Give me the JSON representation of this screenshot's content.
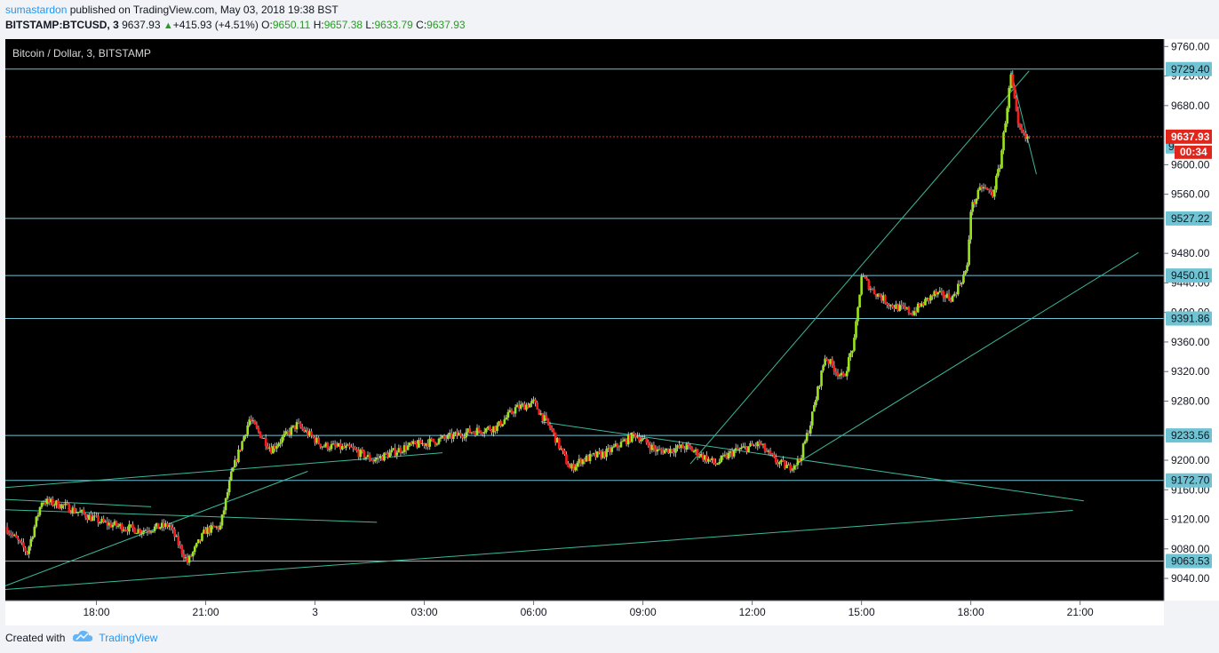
{
  "header": {
    "publisher": "sumastardon",
    "published_text": " published on TradingView.com, May 03, 2018 19:38 BST",
    "symbol": "BITSTAMP:BTCUSD, 3",
    "last": "9637.93",
    "change": "+415.93 (+4.51%)",
    "o_label": "O:",
    "o_value": "9650.11",
    "h_label": "H:",
    "h_value": "9657.38",
    "l_label": "L:",
    "l_value": "9633.79",
    "c_label": "C:",
    "c_value": "9637.93"
  },
  "footer": {
    "created_with": "Created with",
    "brand": "TradingView"
  },
  "colors": {
    "background": "#000000",
    "candle_up": "#9ce51c",
    "candle_down": "#ff1a1a",
    "horizontal_level": "#6fc3d2",
    "trendline": "#3cb89a",
    "last_price": "#e1251b",
    "axis_text": "#131722"
  },
  "chart_data": {
    "type": "candlestick",
    "title": "Bitcoin / Dollar, 3, BITSTAMP",
    "ylim": [
      9010,
      9770
    ],
    "y_ticks": [
      "9760.00",
      "9720.00",
      "9680.00",
      "9600.00",
      "9560.00",
      "9480.00",
      "9440.00",
      "9400.00",
      "9360.00",
      "9320.00",
      "9280.00",
      "9200.00",
      "9160.00",
      "9120.00",
      "9080.00",
      "9040.00"
    ],
    "x_ticks": [
      "18:00",
      "21:00",
      "3",
      "03:00",
      "06:00",
      "09:00",
      "12:00",
      "15:00",
      "18:00",
      "21:00"
    ],
    "x_tick_hours": [
      18,
      21,
      24,
      27,
      30,
      33,
      36,
      39,
      42,
      45
    ],
    "x_range_hours": [
      15.5,
      47.3
    ],
    "grid": false,
    "levels": [
      9729.4,
      9527.22,
      9450.01,
      9391.86,
      9233.56,
      9172.7,
      9063.53
    ],
    "level_labels": [
      "9729.40",
      "9527.22",
      "9450.01",
      "9391.86",
      "9233.56",
      "9172.70",
      "9063.53"
    ],
    "level_partial": "9",
    "last_price": 9637.93,
    "last_price_label": "9637.93",
    "countdown": "00:34",
    "price_path": [
      [
        15.5,
        9110
      ],
      [
        16.1,
        9075
      ],
      [
        16.5,
        9145
      ],
      [
        17.0,
        9140
      ],
      [
        17.5,
        9130
      ],
      [
        18.2,
        9115
      ],
      [
        19.2,
        9105
      ],
      [
        20.0,
        9112
      ],
      [
        20.5,
        9062
      ],
      [
        21.0,
        9105
      ],
      [
        21.4,
        9110
      ],
      [
        21.7,
        9180
      ],
      [
        22.2,
        9255
      ],
      [
        22.8,
        9215
      ],
      [
        23.5,
        9248
      ],
      [
        24.2,
        9220
      ],
      [
        25.0,
        9215
      ],
      [
        25.6,
        9200
      ],
      [
        26.5,
        9218
      ],
      [
        27.3,
        9226
      ],
      [
        28.2,
        9238
      ],
      [
        29.0,
        9245
      ],
      [
        29.5,
        9270
      ],
      [
        30.0,
        9278
      ],
      [
        30.5,
        9240
      ],
      [
        31.0,
        9188
      ],
      [
        31.3,
        9200
      ],
      [
        32.0,
        9210
      ],
      [
        32.8,
        9235
      ],
      [
        33.4,
        9212
      ],
      [
        34.2,
        9218
      ],
      [
        35.0,
        9195
      ],
      [
        35.5,
        9212
      ],
      [
        36.2,
        9222
      ],
      [
        36.6,
        9200
      ],
      [
        37.0,
        9190
      ],
      [
        37.3,
        9200
      ],
      [
        37.6,
        9250
      ],
      [
        38.0,
        9340
      ],
      [
        38.5,
        9310
      ],
      [
        38.8,
        9360
      ],
      [
        39.0,
        9450
      ],
      [
        39.3,
        9430
      ],
      [
        39.8,
        9410
      ],
      [
        40.4,
        9400
      ],
      [
        41.0,
        9425
      ],
      [
        41.5,
        9420
      ],
      [
        41.9,
        9460
      ],
      [
        42.0,
        9540
      ],
      [
        42.3,
        9570
      ],
      [
        42.6,
        9560
      ],
      [
        42.8,
        9600
      ],
      [
        43.1,
        9720
      ],
      [
        43.3,
        9650
      ],
      [
        43.5,
        9635
      ],
      [
        43.6,
        9638
      ]
    ],
    "trendlines": [
      [
        [
          15.5,
          9025
        ],
        [
          44.8,
          9132
        ]
      ],
      [
        [
          15.5,
          9030
        ],
        [
          23.8,
          9185
        ]
      ],
      [
        [
          15.5,
          9163
        ],
        [
          27.5,
          9210
        ]
      ],
      [
        [
          15.5,
          9147
        ],
        [
          19.5,
          9137
        ]
      ],
      [
        [
          15.5,
          9133
        ],
        [
          25.7,
          9116
        ]
      ],
      [
        [
          30.2,
          9252
        ],
        [
          45.1,
          9145
        ]
      ],
      [
        [
          34.3,
          9195
        ],
        [
          43.6,
          9727
        ]
      ],
      [
        [
          37.2,
          9195
        ],
        [
          46.6,
          9481
        ]
      ],
      [
        [
          43.1,
          9727
        ],
        [
          43.8,
          9587
        ]
      ]
    ]
  }
}
